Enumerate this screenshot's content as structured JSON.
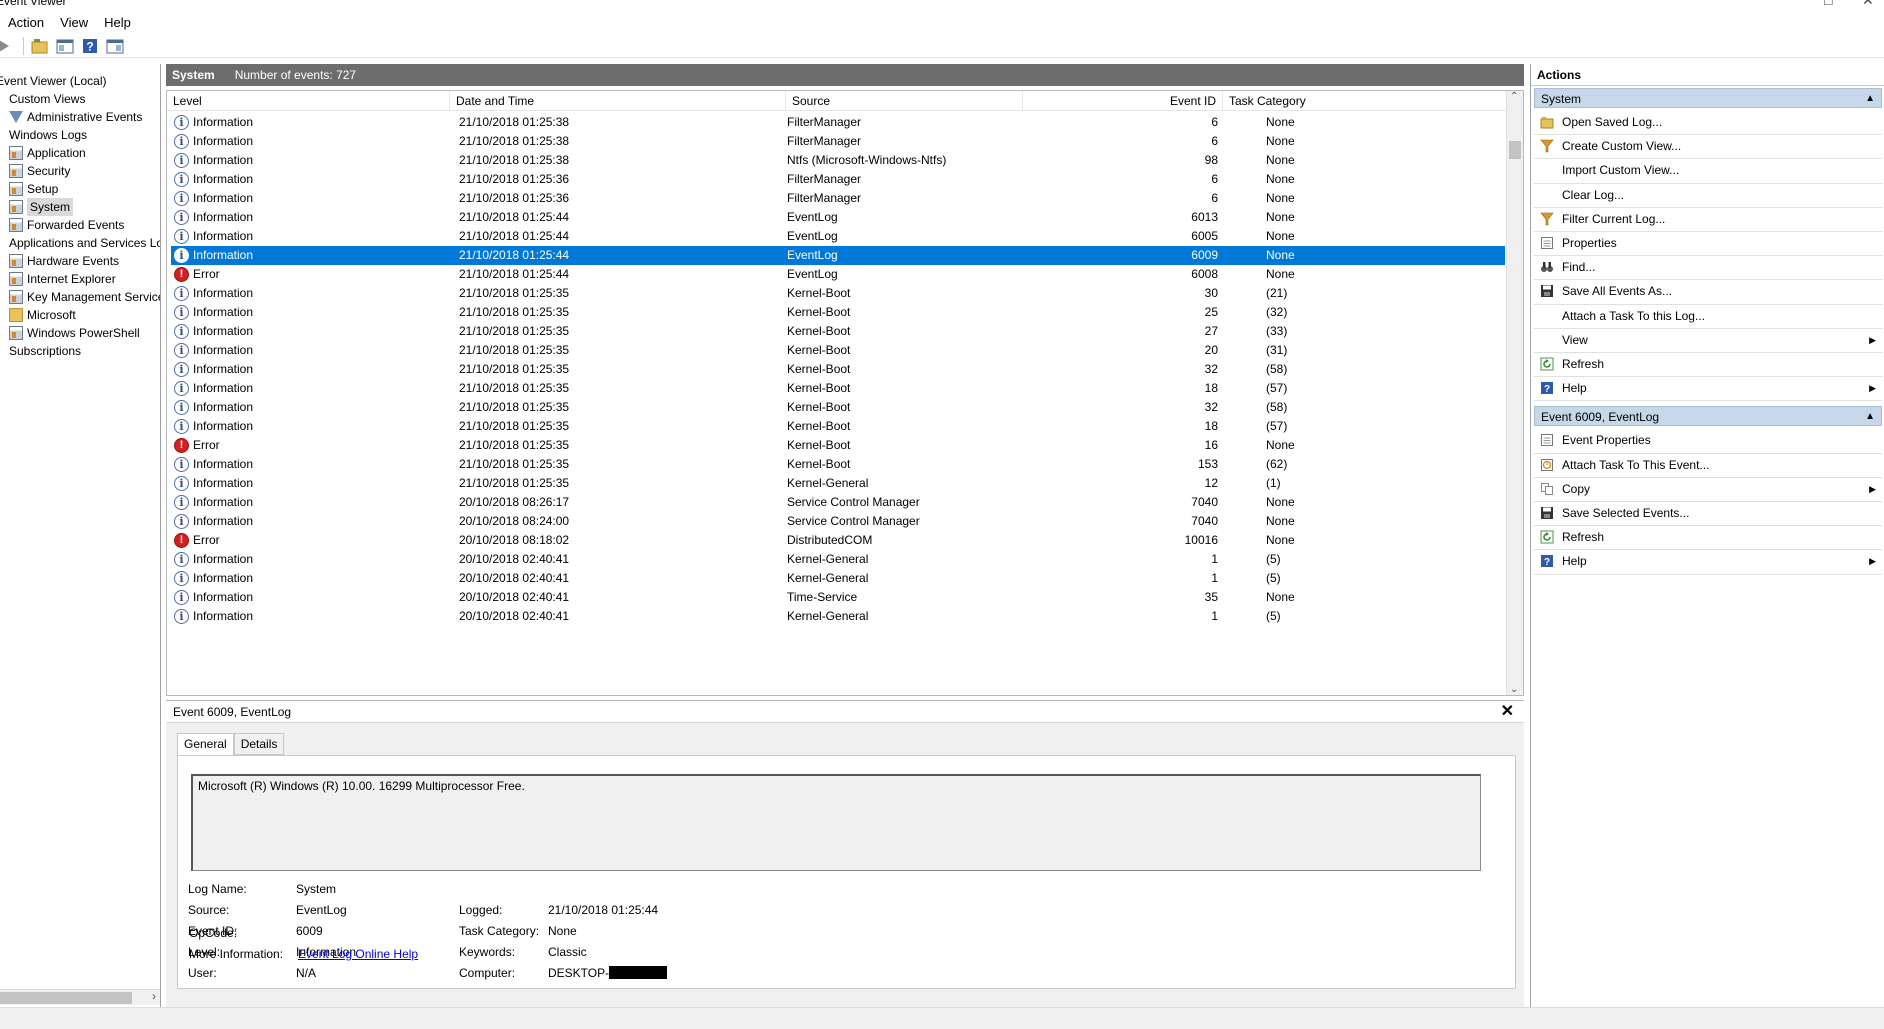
{
  "window": {
    "title": "Event Viewer"
  },
  "menu": [
    "Action",
    "View",
    "Help"
  ],
  "tree": {
    "items": [
      {
        "label": "Event Viewer (Local)",
        "indent": 0,
        "icon": "none"
      },
      {
        "label": "Custom Views",
        "indent": 1,
        "icon": "none"
      },
      {
        "label": "Administrative Events",
        "indent": 2,
        "icon": "funnel"
      },
      {
        "label": "Windows Logs",
        "indent": 1,
        "icon": "none"
      },
      {
        "label": "Application",
        "indent": 2,
        "icon": "log"
      },
      {
        "label": "Security",
        "indent": 2,
        "icon": "log"
      },
      {
        "label": "Setup",
        "indent": 2,
        "icon": "log"
      },
      {
        "label": "System",
        "indent": 2,
        "icon": "log",
        "selected": true
      },
      {
        "label": "Forwarded Events",
        "indent": 2,
        "icon": "log"
      },
      {
        "label": "Applications and Services Lo",
        "indent": 1,
        "icon": "none"
      },
      {
        "label": "Hardware Events",
        "indent": 2,
        "icon": "log"
      },
      {
        "label": "Internet Explorer",
        "indent": 2,
        "icon": "log"
      },
      {
        "label": "Key Management Service",
        "indent": 2,
        "icon": "log"
      },
      {
        "label": "Microsoft",
        "indent": 2,
        "icon": "folder"
      },
      {
        "label": "Windows PowerShell",
        "indent": 2,
        "icon": "log"
      },
      {
        "label": "Subscriptions",
        "indent": 1,
        "icon": "none"
      }
    ]
  },
  "log": {
    "name": "System",
    "count": "Number of events: 727",
    "columns": [
      "Level",
      "Date and Time",
      "Source",
      "Event ID",
      "Task Category"
    ],
    "rows": [
      {
        "level": "Information",
        "date": "21/10/2018 01:25:38",
        "source": "FilterManager",
        "id": "6",
        "category": "None"
      },
      {
        "level": "Information",
        "date": "21/10/2018 01:25:38",
        "source": "FilterManager",
        "id": "6",
        "category": "None"
      },
      {
        "level": "Information",
        "date": "21/10/2018 01:25:38",
        "source": "Ntfs (Microsoft-Windows-Ntfs)",
        "id": "98",
        "category": "None"
      },
      {
        "level": "Information",
        "date": "21/10/2018 01:25:36",
        "source": "FilterManager",
        "id": "6",
        "category": "None"
      },
      {
        "level": "Information",
        "date": "21/10/2018 01:25:36",
        "source": "FilterManager",
        "id": "6",
        "category": "None"
      },
      {
        "level": "Information",
        "date": "21/10/2018 01:25:44",
        "source": "EventLog",
        "id": "6013",
        "category": "None"
      },
      {
        "level": "Information",
        "date": "21/10/2018 01:25:44",
        "source": "EventLog",
        "id": "6005",
        "category": "None"
      },
      {
        "level": "Information",
        "date": "21/10/2018 01:25:44",
        "source": "EventLog",
        "id": "6009",
        "category": "None",
        "selected": true
      },
      {
        "level": "Error",
        "date": "21/10/2018 01:25:44",
        "source": "EventLog",
        "id": "6008",
        "category": "None"
      },
      {
        "level": "Information",
        "date": "21/10/2018 01:25:35",
        "source": "Kernel-Boot",
        "id": "30",
        "category": "(21)"
      },
      {
        "level": "Information",
        "date": "21/10/2018 01:25:35",
        "source": "Kernel-Boot",
        "id": "25",
        "category": "(32)"
      },
      {
        "level": "Information",
        "date": "21/10/2018 01:25:35",
        "source": "Kernel-Boot",
        "id": "27",
        "category": "(33)"
      },
      {
        "level": "Information",
        "date": "21/10/2018 01:25:35",
        "source": "Kernel-Boot",
        "id": "20",
        "category": "(31)"
      },
      {
        "level": "Information",
        "date": "21/10/2018 01:25:35",
        "source": "Kernel-Boot",
        "id": "32",
        "category": "(58)"
      },
      {
        "level": "Information",
        "date": "21/10/2018 01:25:35",
        "source": "Kernel-Boot",
        "id": "18",
        "category": "(57)"
      },
      {
        "level": "Information",
        "date": "21/10/2018 01:25:35",
        "source": "Kernel-Boot",
        "id": "32",
        "category": "(58)"
      },
      {
        "level": "Information",
        "date": "21/10/2018 01:25:35",
        "source": "Kernel-Boot",
        "id": "18",
        "category": "(57)"
      },
      {
        "level": "Error",
        "date": "21/10/2018 01:25:35",
        "source": "Kernel-Boot",
        "id": "16",
        "category": "None"
      },
      {
        "level": "Information",
        "date": "21/10/2018 01:25:35",
        "source": "Kernel-Boot",
        "id": "153",
        "category": "(62)"
      },
      {
        "level": "Information",
        "date": "21/10/2018 01:25:35",
        "source": "Kernel-General",
        "id": "12",
        "category": "(1)"
      },
      {
        "level": "Information",
        "date": "20/10/2018 08:26:17",
        "source": "Service Control Manager",
        "id": "7040",
        "category": "None"
      },
      {
        "level": "Information",
        "date": "20/10/2018 08:24:00",
        "source": "Service Control Manager",
        "id": "7040",
        "category": "None"
      },
      {
        "level": "Error",
        "date": "20/10/2018 08:18:02",
        "source": "DistributedCOM",
        "id": "10016",
        "category": "None"
      },
      {
        "level": "Information",
        "date": "20/10/2018 02:40:41",
        "source": "Kernel-General",
        "id": "1",
        "category": "(5)"
      },
      {
        "level": "Information",
        "date": "20/10/2018 02:40:41",
        "source": "Kernel-General",
        "id": "1",
        "category": "(5)"
      },
      {
        "level": "Information",
        "date": "20/10/2018 02:40:41",
        "source": "Time-Service",
        "id": "35",
        "category": "None"
      },
      {
        "level": "Information",
        "date": "20/10/2018 02:40:41",
        "source": "Kernel-General",
        "id": "1",
        "category": "(5)"
      }
    ]
  },
  "detail": {
    "title": "Event 6009, EventLog",
    "tabs": [
      "General",
      "Details"
    ],
    "description": "Microsoft (R) Windows (R) 10.00. 16299  Multiprocessor Free.",
    "fields": {
      "log_name_label": "Log Name:",
      "log_name": "System",
      "source_label": "Source:",
      "source": "EventLog",
      "logged_label": "Logged:",
      "logged": "21/10/2018 01:25:44",
      "event_id_label": "Event ID:",
      "event_id": "6009",
      "task_category_label": "Task Category:",
      "task_category": "None",
      "level_label": "Level:",
      "level": "Information",
      "keywords_label": "Keywords:",
      "keywords": "Classic",
      "user_label": "User:",
      "user": "N/A",
      "computer_label": "Computer:",
      "computer": "DESKTOP-",
      "opcode_label": "OpCode:",
      "more_info_label": "More Information:",
      "more_info_link": "Event Log Online Help"
    }
  },
  "actions": {
    "title": "Actions",
    "sections": [
      {
        "header": "System",
        "items": [
          {
            "label": "Open Saved Log...",
            "icon": "folder-open-icon"
          },
          {
            "label": "Create Custom View...",
            "icon": "funnel-icon"
          },
          {
            "label": "Import Custom View...",
            "icon": "none"
          },
          {
            "label": "Clear Log...",
            "icon": "none"
          },
          {
            "label": "Filter Current Log...",
            "icon": "funnel-icon"
          },
          {
            "label": "Properties",
            "icon": "properties-icon"
          },
          {
            "label": "Find...",
            "icon": "binoculars-icon"
          },
          {
            "label": "Save All Events As...",
            "icon": "save-icon"
          },
          {
            "label": "Attach a Task To this Log...",
            "icon": "none"
          },
          {
            "label": "View",
            "icon": "none",
            "submenu": true
          },
          {
            "label": "Refresh",
            "icon": "refresh-icon"
          },
          {
            "label": "Help",
            "icon": "help-icon",
            "submenu": true
          }
        ]
      },
      {
        "header": "Event 6009, EventLog",
        "items": [
          {
            "label": "Event Properties",
            "icon": "properties-icon"
          },
          {
            "label": "Attach Task To This Event...",
            "icon": "task-icon"
          },
          {
            "label": "Copy",
            "icon": "copy-icon",
            "submenu": true
          },
          {
            "label": "Save Selected Events...",
            "icon": "save-icon"
          },
          {
            "label": "Refresh",
            "icon": "refresh-icon"
          },
          {
            "label": "Help",
            "icon": "help-icon",
            "submenu": true
          }
        ]
      }
    ]
  },
  "colors": {
    "selection": "#0078d7",
    "header_bar": "#6d6d6d",
    "section_header": "#c6d7e9",
    "error": "#d42020",
    "info": "#2e4f82"
  }
}
